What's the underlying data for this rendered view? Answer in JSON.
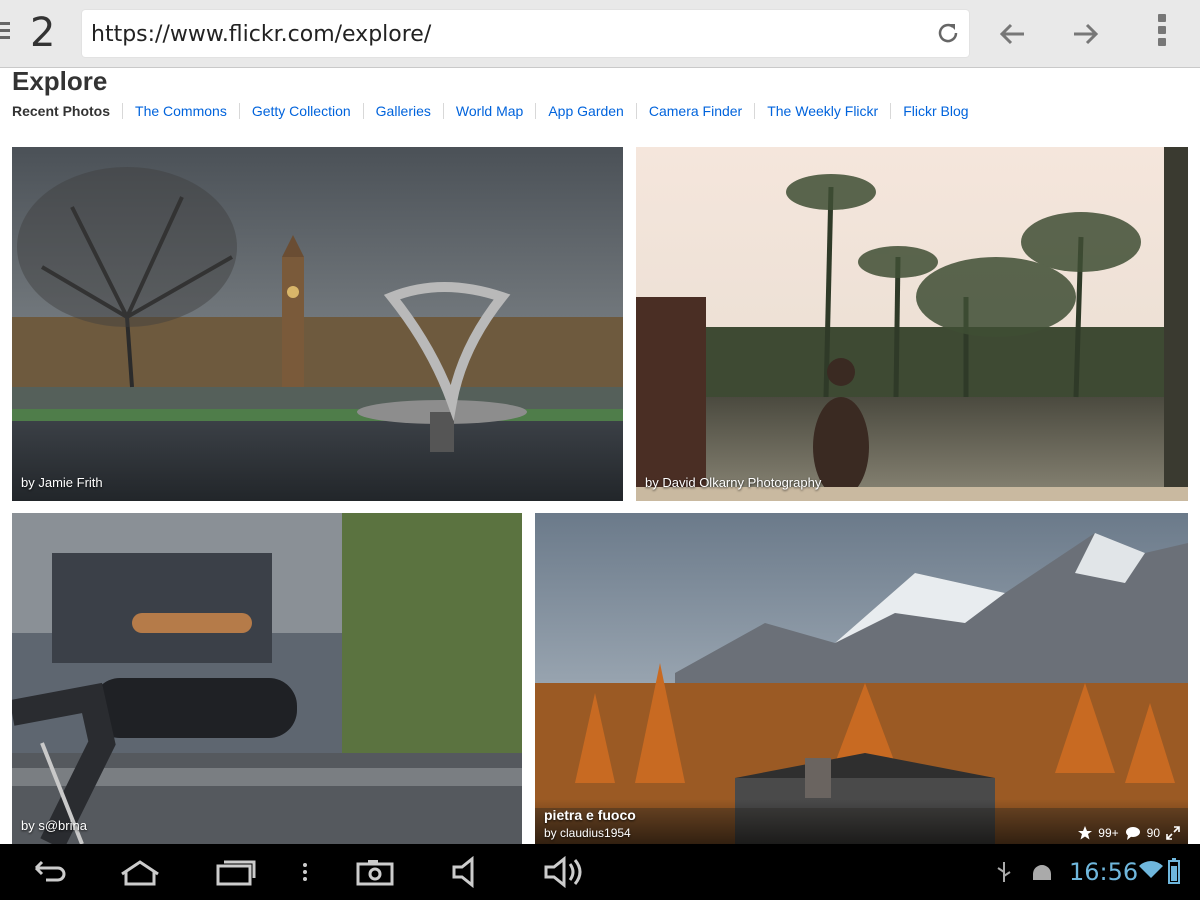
{
  "browser": {
    "tab_count": "2",
    "url": "https://www.flickr.com/explore/",
    "icons": [
      "menu-icon",
      "reload-icon",
      "back-arrow-icon",
      "forward-arrow-icon",
      "overflow-menu-icon"
    ]
  },
  "page": {
    "title": "Explore",
    "nav": [
      {
        "label": "Recent Photos",
        "active": true
      },
      {
        "label": "The Commons"
      },
      {
        "label": "Getty Collection"
      },
      {
        "label": "Galleries"
      },
      {
        "label": "World Map"
      },
      {
        "label": "App Garden"
      },
      {
        "label": "Camera Finder"
      },
      {
        "label": "The Weekly Flickr"
      },
      {
        "label": "Flickr Blog"
      }
    ],
    "photos": [
      {
        "credit": "by Jamie Frith"
      },
      {
        "credit": "by David Olkarny Photography"
      },
      {
        "credit": "by s@brina"
      },
      {
        "title": "pietra e fuoco",
        "credit": "by claudius1954",
        "faves": "99+",
        "comments": "90"
      }
    ],
    "link_color": "#0063dc"
  },
  "system": {
    "clock": "16:56",
    "clock_color": "#6fb7dd",
    "icons": [
      "back-icon",
      "home-icon",
      "recent-apps-icon",
      "menu-dots-icon",
      "screenshot-icon",
      "volume-down-icon",
      "volume-up-icon",
      "usb-icon",
      "android-icon",
      "wifi-icon",
      "battery-icon"
    ]
  }
}
